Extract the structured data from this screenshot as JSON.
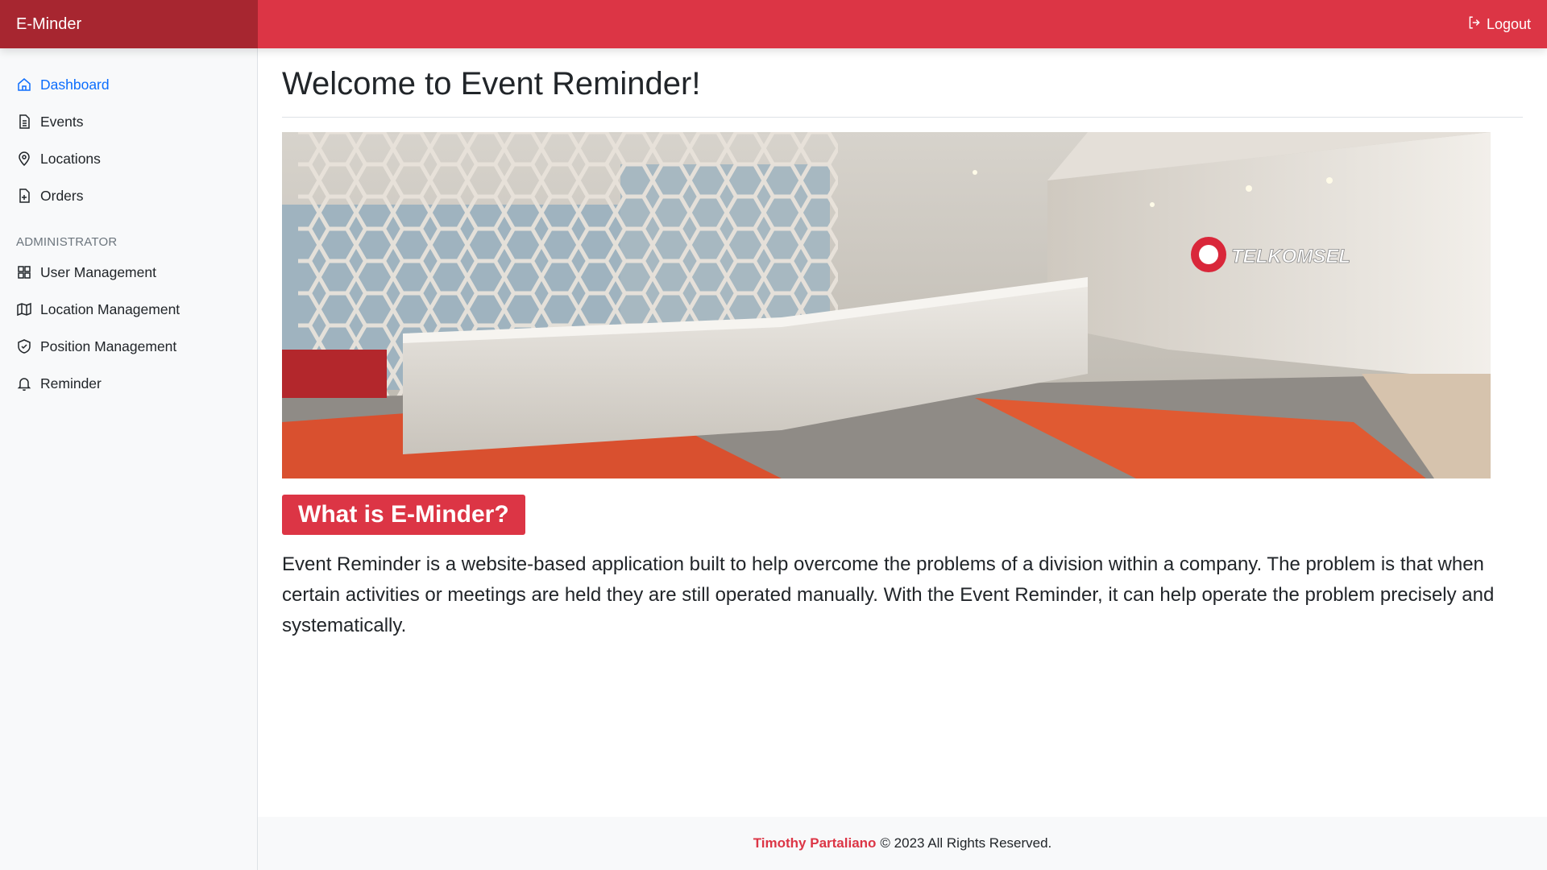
{
  "app": {
    "brand": "E-Minder"
  },
  "topbar": {
    "logout_label": "Logout"
  },
  "sidebar": {
    "items": [
      {
        "label": "Dashboard",
        "icon": "home-icon",
        "active": true
      },
      {
        "label": "Events",
        "icon": "document-icon"
      },
      {
        "label": "Locations",
        "icon": "map-pin-icon"
      },
      {
        "label": "Orders",
        "icon": "file-plus-icon"
      }
    ],
    "admin_heading": "ADMINISTRATOR",
    "admin_items": [
      {
        "label": "User Management",
        "icon": "grid-icon"
      },
      {
        "label": "Location Management",
        "icon": "map-icon"
      },
      {
        "label": "Position Management",
        "icon": "shield-check-icon"
      },
      {
        "label": "Reminder",
        "icon": "bell-icon"
      }
    ]
  },
  "main": {
    "title": "Welcome to Event Reminder!",
    "hero_logo_text": "TELKOMSEL",
    "section_title": "What is E-Minder?",
    "description": "Event Reminder is a website-based application built to help overcome the problems of a division within a company. The problem is that when certain activities or meetings are held they are still operated manually. With the Event Reminder, it can help operate the problem precisely and systematically."
  },
  "footer": {
    "author": "Timothy Partaliano",
    "copyright": "© 2023 All Rights Reserved."
  },
  "colors": {
    "primary_red": "#dc3545",
    "brand_dark_red": "#a72630",
    "active_link": "#0d6efd",
    "sidebar_bg": "#f8f9fa"
  }
}
